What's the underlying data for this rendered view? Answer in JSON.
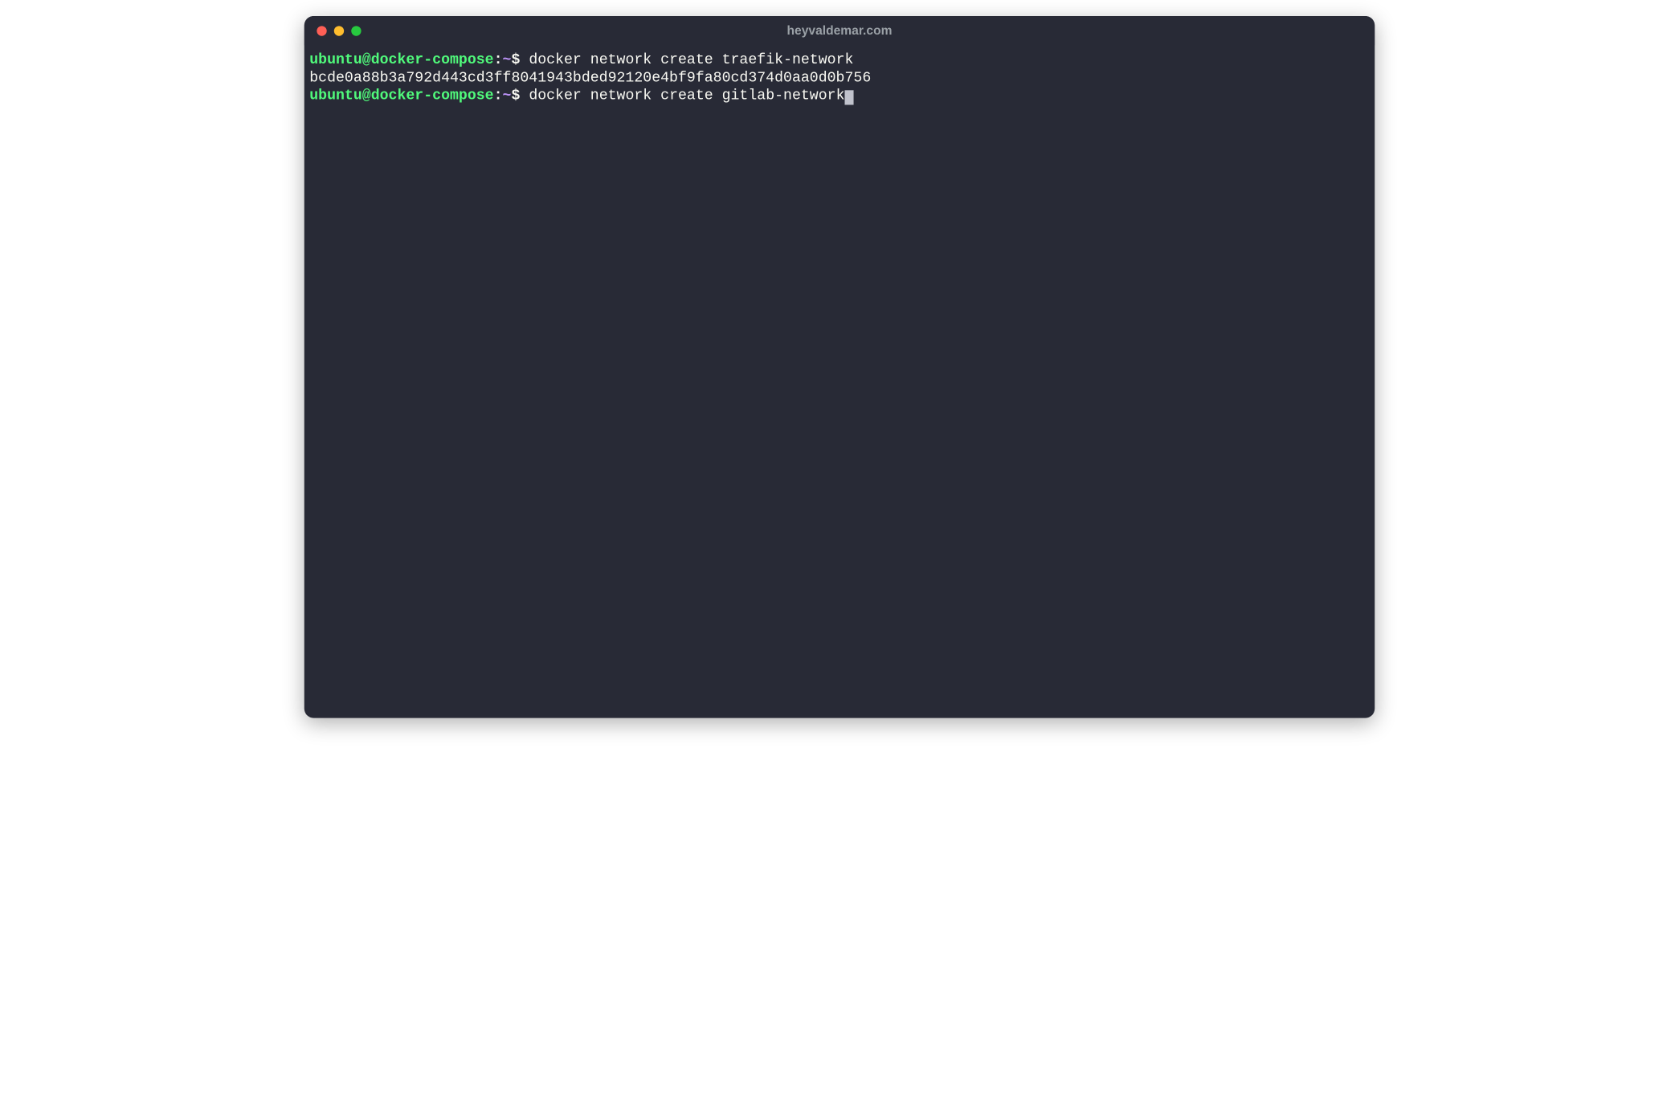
{
  "window": {
    "title": "heyvaldemar.com"
  },
  "prompt": {
    "user_host": "ubuntu@docker-compose",
    "colon": ":",
    "path": "~",
    "symbol": "$"
  },
  "lines": {
    "cmd1": " docker network create traefik-network",
    "out1": "bcde0a88b3a792d443cd3ff8041943bded92120e4bf9fa80cd374d0aa0d0b756",
    "cmd2": " docker network create gitlab-network"
  }
}
